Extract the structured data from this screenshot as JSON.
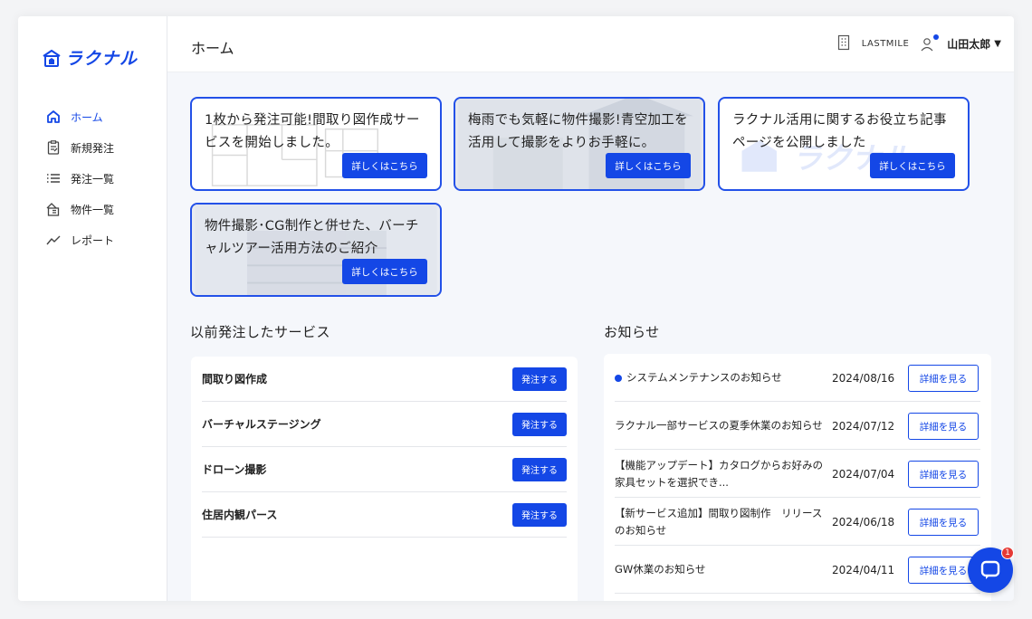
{
  "app": {
    "logo_text": "ラクナル",
    "brand_color": "#1447e6"
  },
  "sidebar": {
    "items": [
      {
        "label": "ホーム",
        "icon": "home-icon",
        "active": true
      },
      {
        "label": "新規発注",
        "icon": "clipboard-icon",
        "active": false
      },
      {
        "label": "発注一覧",
        "icon": "list-icon",
        "active": false
      },
      {
        "label": "物件一覧",
        "icon": "building-icon",
        "active": false
      },
      {
        "label": "レポート",
        "icon": "chart-line-icon",
        "active": false
      }
    ]
  },
  "header": {
    "title": "ホーム",
    "company": "LASTMILE",
    "user_name": "山田太郎"
  },
  "banners": [
    {
      "text": "1枚から発注可能!間取り図作成サービスを開始しました。",
      "button": "詳しくはこちら"
    },
    {
      "text": "梅雨でも気軽に物件撮影!青空加工を活用して撮影をよりお手軽に。",
      "button": "詳しくはこちら"
    },
    {
      "text": "ラクナル活用に関するお役立ち記事ページを公開しました",
      "button": "詳しくはこちら"
    },
    {
      "text": "物件撮影･CG制作と併せた、バーチャルツアー活用方法のご紹介",
      "button": "詳しくはこちら"
    }
  ],
  "services": {
    "title": "以前発注したサービス",
    "items": [
      {
        "name": "間取り図作成",
        "button": "発注する"
      },
      {
        "name": "バーチャルステージング",
        "button": "発注する"
      },
      {
        "name": "ドローン撮影",
        "button": "発注する"
      },
      {
        "name": "住居内観パース",
        "button": "発注する"
      }
    ]
  },
  "news": {
    "title": "お知らせ",
    "items": [
      {
        "title": "システムメンテナンスのお知らせ",
        "date": "2024/08/16",
        "button": "詳細を見る",
        "unread": true
      },
      {
        "title": "ラクナル一部サービスの夏季休業のお知らせ",
        "date": "2024/07/12",
        "button": "詳細を見る",
        "unread": false
      },
      {
        "title": "【機能アップデート】カタログからお好みの家具セットを選択でき...",
        "date": "2024/07/04",
        "button": "詳細を見る",
        "unread": false
      },
      {
        "title": "【新サービス追加】間取り図制作　リリースのお知らせ",
        "date": "2024/06/18",
        "button": "詳細を見る",
        "unread": false
      },
      {
        "title": "GW休業のお知らせ",
        "date": "2024/04/11",
        "button": "詳細を見る",
        "unread": false
      }
    ]
  },
  "chat": {
    "badge_count": "1",
    "icon": "chat-bubble-icon"
  }
}
